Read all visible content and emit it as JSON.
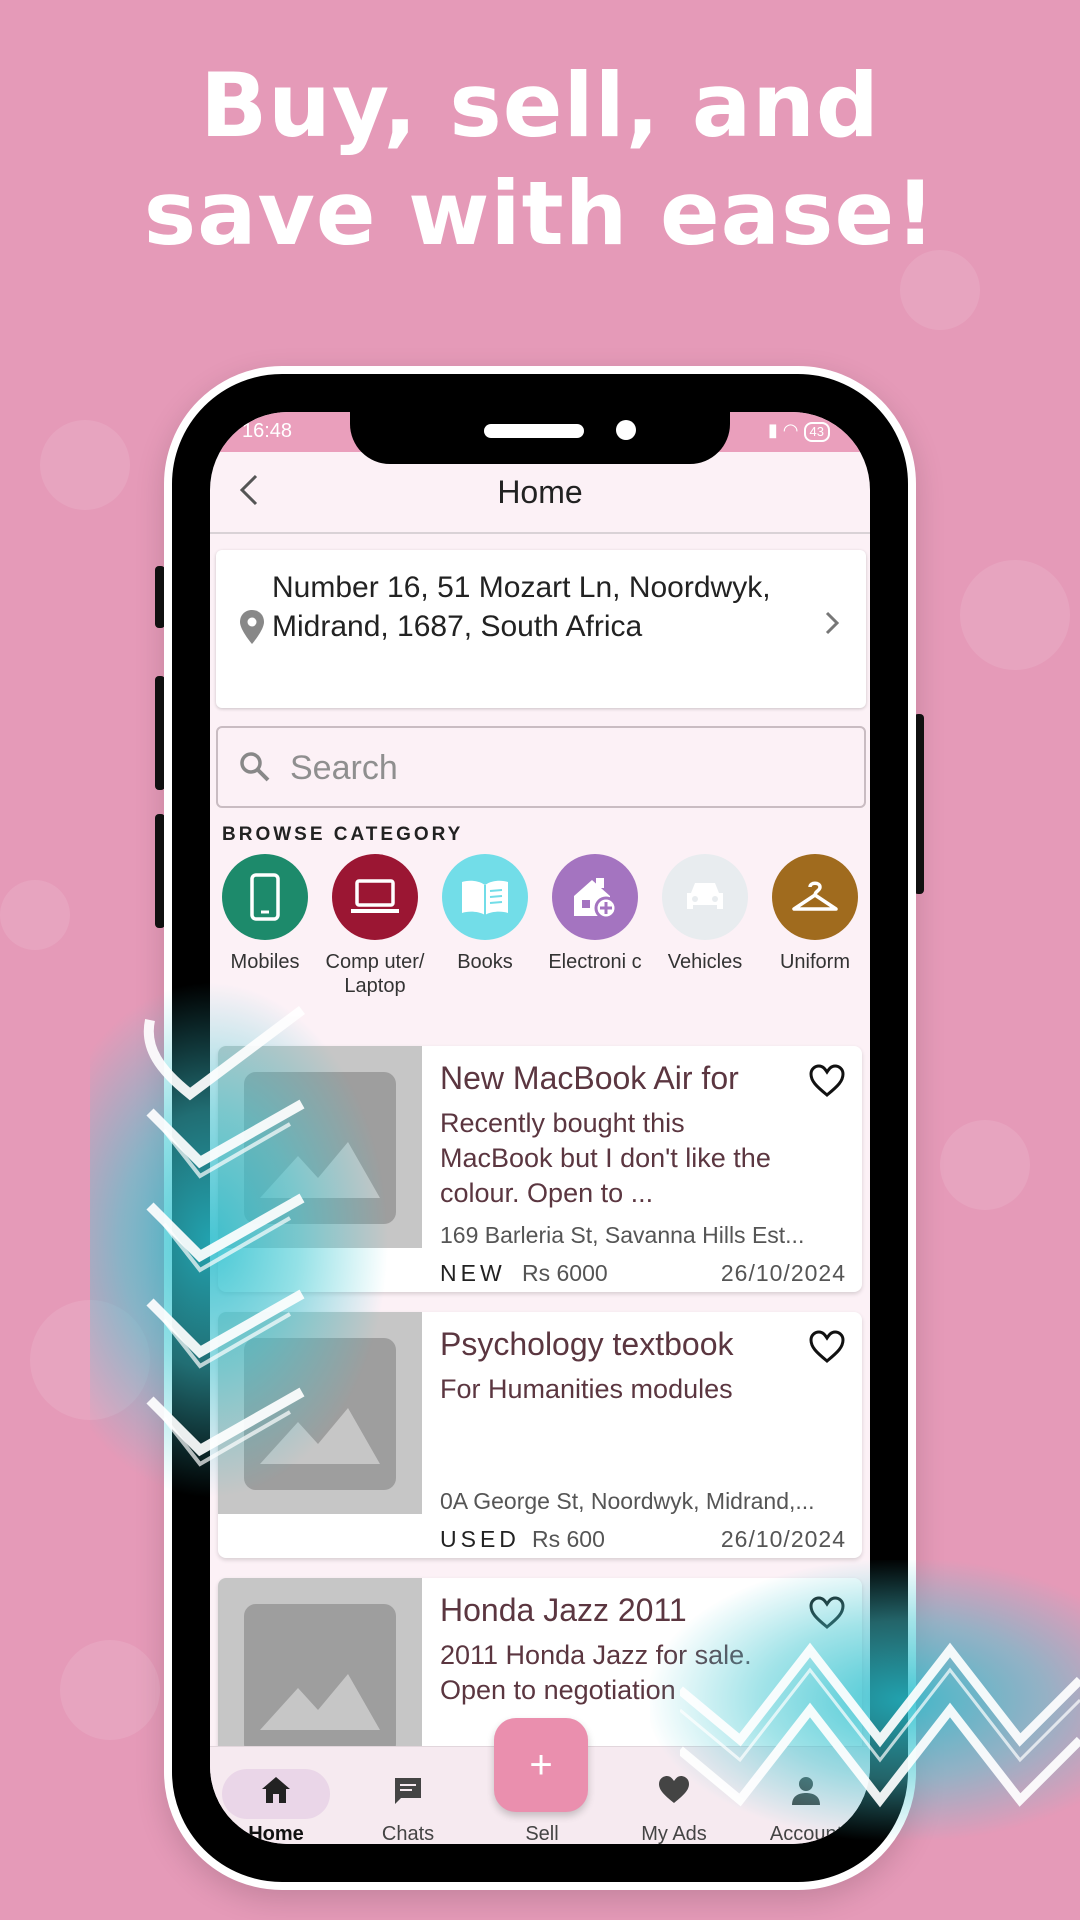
{
  "headline": {
    "line1": "Buy, sell, and",
    "line2": "save with ease!"
  },
  "status_bar": {
    "time": "16:48",
    "battery": "43"
  },
  "app_bar": {
    "title": "Home"
  },
  "address": {
    "text": "Number 16, 51 Mozart Ln, Noordwyk, Midrand, 1687, South Africa"
  },
  "search": {
    "placeholder": "Search"
  },
  "browse_category": {
    "heading": "BROWSE CATEGORY",
    "items": [
      {
        "label": "Mobiles",
        "color": "#1d8a6b",
        "icon": "phone-icon"
      },
      {
        "label": "Comp uter/ Laptop",
        "color": "#9b1633",
        "icon": "laptop-icon"
      },
      {
        "label": "Books",
        "color": "#72dde8",
        "icon": "book-icon"
      },
      {
        "label": "Electroni c",
        "color": "#a474c0",
        "icon": "house-plus-icon"
      },
      {
        "label": "Vehicles",
        "color": "#e8ecef",
        "icon": "car-icon"
      },
      {
        "label": "Uniform",
        "color": "#a06b1e",
        "icon": "hanger-icon"
      }
    ]
  },
  "ads": [
    {
      "title": "New MacBook Air for",
      "description": "Recently bought this MacBook but I don't like the colour. Open to ...",
      "location": "169 Barleria St, Savanna Hills Est...",
      "condition": "NEW",
      "price": "Rs 6000",
      "date": "26/10/2024"
    },
    {
      "title": "Psychology textbook",
      "description": "For Humanities modules",
      "location": "0A George St, Noordwyk, Midrand,...",
      "condition": "USED",
      "price": "Rs 600",
      "date": "26/10/2024"
    },
    {
      "title": "Honda Jazz 2011",
      "description": "2011 Honda Jazz for sale. Open to negotiation",
      "location": "",
      "condition": "",
      "price": "",
      "date": ""
    }
  ],
  "nav": {
    "items": [
      {
        "label": "Home",
        "icon": "home-icon",
        "active": true
      },
      {
        "label": "Chats",
        "icon": "chat-icon"
      },
      {
        "label": "Sell",
        "icon": "plus-icon"
      },
      {
        "label": "My Ads",
        "icon": "heart-icon"
      },
      {
        "label": "Account",
        "icon": "account-icon"
      }
    ],
    "fab": "+"
  },
  "colors": {
    "background": "#e59ab8",
    "accent": "#ea8fae",
    "text_brown": "#5b3640"
  }
}
